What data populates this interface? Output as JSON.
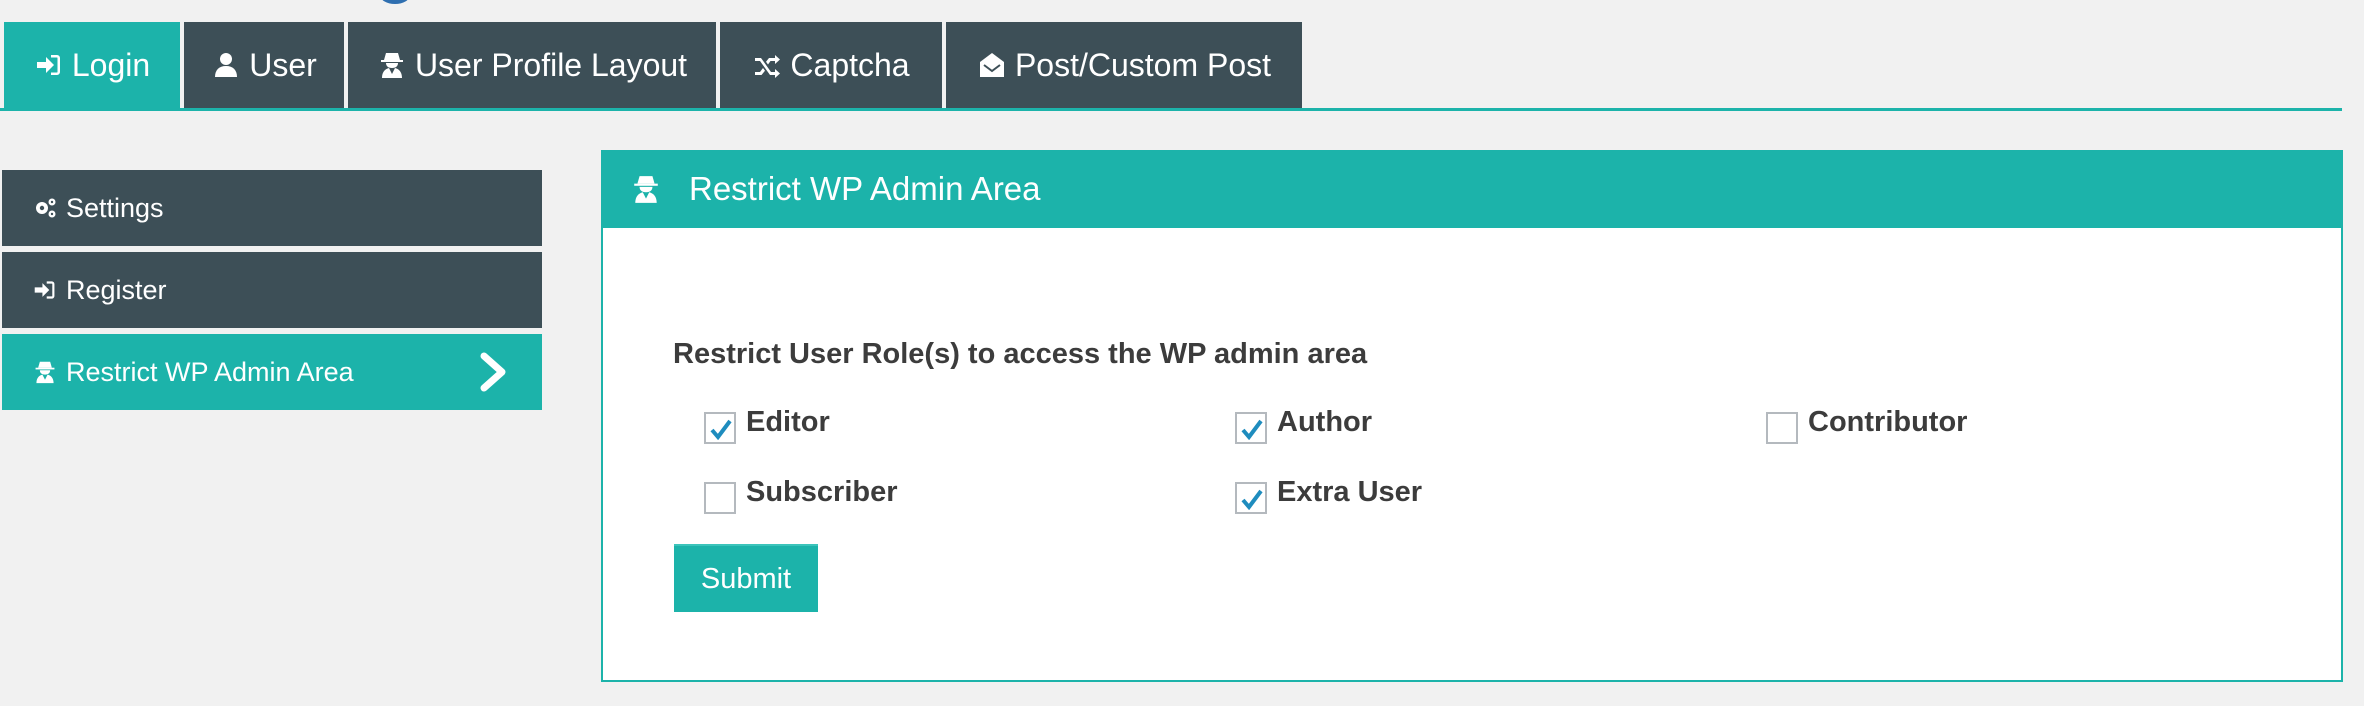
{
  "tabs": [
    {
      "label": "Login",
      "icon": "sign-in-icon",
      "active": true
    },
    {
      "label": "User",
      "icon": "user-icon",
      "active": false
    },
    {
      "label": "User Profile Layout",
      "icon": "user-secret-icon",
      "active": false
    },
    {
      "label": "Captcha",
      "icon": "random-icon",
      "active": false
    },
    {
      "label": "Post/Custom Post",
      "icon": "envelope-open-icon",
      "active": false
    }
  ],
  "sidebar": {
    "items": [
      {
        "label": "Settings",
        "icon": "gears-icon",
        "active": false
      },
      {
        "label": "Register",
        "icon": "sign-in-icon",
        "active": false
      },
      {
        "label": "Restrict WP Admin Area",
        "icon": "user-secret-icon",
        "active": true
      }
    ]
  },
  "panel": {
    "title": "Restrict WP Admin Area",
    "icon": "user-secret-icon",
    "field_label": "Restrict User Role(s) to access the WP admin area",
    "roles": [
      {
        "label": "Editor",
        "checked": true
      },
      {
        "label": "Author",
        "checked": true
      },
      {
        "label": "Contributor",
        "checked": false
      },
      {
        "label": "Subscriber",
        "checked": false
      },
      {
        "label": "Extra User",
        "checked": true
      }
    ],
    "submit_label": "Submit"
  },
  "colors": {
    "accent": "#1cb3aa",
    "dark": "#3d4f57",
    "checkmark": "#1e8cbe",
    "text": "#3c3c3c"
  }
}
